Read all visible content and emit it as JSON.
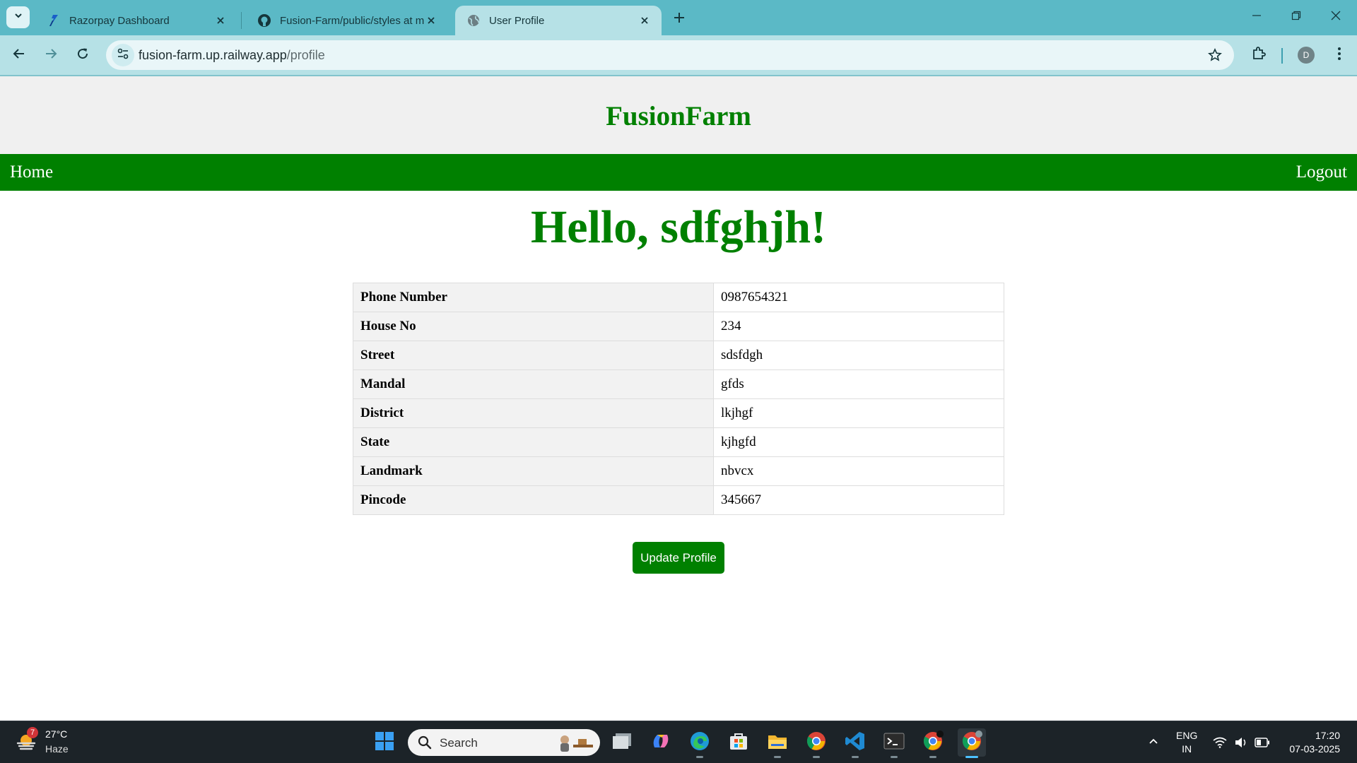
{
  "browser": {
    "tabs": [
      {
        "title": "Razorpay Dashboard",
        "favicon": "razorpay-icon",
        "active": false
      },
      {
        "title": "Fusion-Farm/public/styles at main",
        "favicon": "github-icon",
        "active": false
      },
      {
        "title": "User Profile",
        "favicon": "globe-icon",
        "active": true
      }
    ],
    "address": {
      "host": "fusion-farm.up.railway.app",
      "path": "/profile"
    },
    "profile_initial": "D"
  },
  "site": {
    "title": "FusionFarm",
    "nav": {
      "home": "Home",
      "logout": "Logout"
    }
  },
  "profile": {
    "greeting": "Hello, sdfghjh!",
    "fields": [
      {
        "label": "Phone Number",
        "value": "0987654321"
      },
      {
        "label": "House No",
        "value": "234"
      },
      {
        "label": "Street",
        "value": "sdsfdgh"
      },
      {
        "label": "Mandal",
        "value": "gfds"
      },
      {
        "label": "District",
        "value": "lkjhgf"
      },
      {
        "label": "State",
        "value": "kjhgfd"
      },
      {
        "label": "Landmark",
        "value": "nbvcx"
      },
      {
        "label": "Pincode",
        "value": "345667"
      }
    ],
    "update_button": "Update Profile"
  },
  "colors": {
    "brand_green": "#008000",
    "header_bg": "#f0f0f0",
    "browser_frame": "#5bb9c6"
  },
  "taskbar": {
    "weather": {
      "temp": "27°C",
      "desc": "Haze",
      "badge": "7"
    },
    "search_label": "Search",
    "lang": {
      "line1": "ENG",
      "line2": "IN"
    },
    "clock": {
      "time": "17:20",
      "date": "07-03-2025"
    },
    "chrome_badge": "D"
  }
}
